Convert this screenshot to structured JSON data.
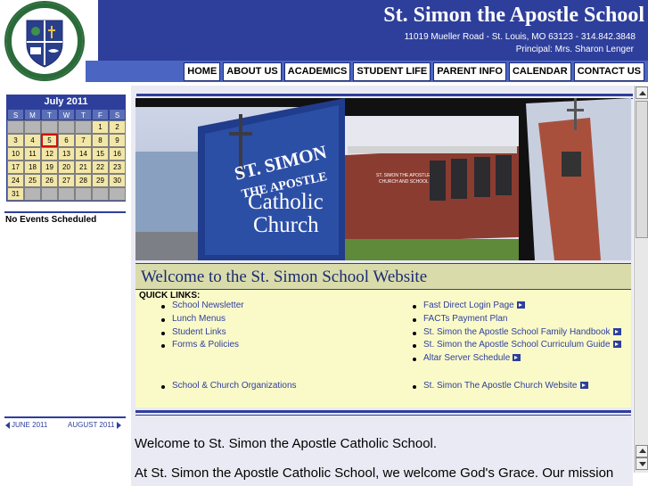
{
  "header": {
    "school_name": "St. Simon the Apostle School",
    "address": "11019 Mueller Road - St. Louis, MO 63123 - 314.842.3848",
    "principal": "Principal: Mrs. Sharon Lenger",
    "logo_text_top": "ST. SIMON",
    "logo_text_sub": "THE APOSTLE",
    "colors": {
      "header_bg": "#2e3f9b",
      "navbar_bg": "#4a66c2"
    }
  },
  "nav": [
    {
      "label": "HOME"
    },
    {
      "label": "ABOUT US"
    },
    {
      "label": "ACADEMICS"
    },
    {
      "label": "STUDENT LIFE"
    },
    {
      "label": "PARENT INFO"
    },
    {
      "label": "CALENDAR"
    },
    {
      "label": "CONTACT US"
    }
  ],
  "calendar": {
    "title": "July 2011",
    "days_of_week": [
      "S",
      "M",
      "T",
      "W",
      "T",
      "F",
      "S"
    ],
    "today": "5",
    "weeks": [
      [
        "",
        "",
        "",
        "",
        "",
        "1",
        "2"
      ],
      [
        "3",
        "4",
        "5",
        "6",
        "7",
        "8",
        "9"
      ],
      [
        "10",
        "11",
        "12",
        "13",
        "14",
        "15",
        "16"
      ],
      [
        "17",
        "18",
        "19",
        "20",
        "21",
        "22",
        "23"
      ],
      [
        "24",
        "25",
        "26",
        "27",
        "28",
        "29",
        "30"
      ],
      [
        "31",
        "",
        "",
        "",
        "",
        "",
        ""
      ]
    ],
    "events_text": "No Events Scheduled",
    "prev_label": "JUNE 2011",
    "next_label": "AUGUST 2011"
  },
  "photo": {
    "sign_line1": "ST. SIMON",
    "sign_line2": "THE APOSTLE",
    "sign_line3": "Catholic",
    "sign_line4": "Church",
    "building_text_line1": "ST. SIMON THE APOSTLE",
    "building_text_line2": "CHURCH AND SCHOOL"
  },
  "main": {
    "welcome_title": "Welcome to the St. Simon School Website",
    "quick_links_label": "QUICK LINKS:",
    "left_links": [
      {
        "label": "School Newsletter"
      },
      {
        "label": "Lunch Menus"
      },
      {
        "label": "Student Links"
      },
      {
        "label": "Forms & Policies"
      },
      {
        "label": "School & Church Organizations"
      }
    ],
    "right_links": [
      {
        "label": "Fast Direct Login Page",
        "external": true
      },
      {
        "label": "FACTs Payment Plan",
        "external": false
      },
      {
        "label": "St. Simon the Apostle School Family Handbook",
        "external": true
      },
      {
        "label": "St. Simon the Apostle School Curriculum Guide",
        "external": true
      },
      {
        "label": "Altar Server Schedule",
        "external": true
      },
      {
        "label": "St. Simon The Apostle Church Website",
        "external": true
      }
    ],
    "welcome_text": "Welcome to St. Simon the Apostle Catholic School.",
    "cut_text": "At St. Simon the Apostle Catholic School, we welcome God's Grace. Our mission"
  }
}
